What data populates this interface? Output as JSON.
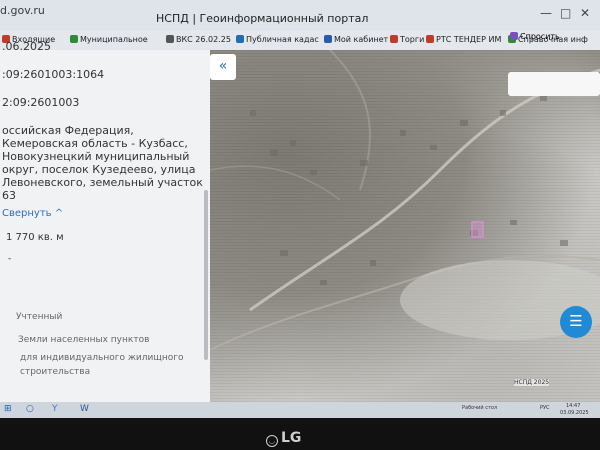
{
  "browser": {
    "address_fragment": "d.gov.ru",
    "window_title": "НСПД | Геоинформационный портал",
    "controls": [
      "—",
      "□",
      "✕"
    ]
  },
  "bookmarks": [
    {
      "label": "Входящие",
      "color": "#c23b2a"
    },
    {
      "label": "Муниципальное",
      "color": "#2e8b3a"
    },
    {
      "label": "ВКС 26.02.25",
      "color": "#555555"
    },
    {
      "label": "Публичная кадас",
      "color": "#1f6fb2"
    },
    {
      "label": "Мой кабинет",
      "color": "#2d5aa8"
    },
    {
      "label": "Торги",
      "color": "#c23b2a"
    },
    {
      "label": "РТС ТЕНДЕР ИМ",
      "color": "#c23b2a"
    },
    {
      "label": "Справочная инф",
      "color": "#2e8b3a"
    },
    {
      "label": "Спросить",
      "color": "#7a4fc0"
    }
  ],
  "panel": {
    "date_fragment": ".06.2025",
    "cad_number": ":09:2601003:1064",
    "cad_quarter": "2:09:2601003",
    "address_lines": [
      "оссийская Федерация,",
      "Кемеровская область - Кузбасс,",
      "Новокузнецкий муниципальный",
      "округ, поселок Кузедеево, улица",
      "Левоневского, земельный участок",
      "63"
    ],
    "collapse_link": "Свернуть",
    "area": "1 770 кв. м",
    "dash": "-",
    "status": "Учтенный",
    "category": "Земли населенных пунктов",
    "use_lines": [
      "для индивидуального жилищного",
      "строительства"
    ]
  },
  "map": {
    "collapse_icon": "«",
    "scale_text": "НСПД 2025",
    "parcel_color": "#d98fd2",
    "chat_icon": "chat-icon"
  },
  "taskbar": {
    "tray_layout": "РУС",
    "tray_time": "14:47",
    "tray_date": "03.09.2025",
    "tray_label": "Рабочий стол"
  },
  "monitor": {
    "brand": "LG"
  }
}
